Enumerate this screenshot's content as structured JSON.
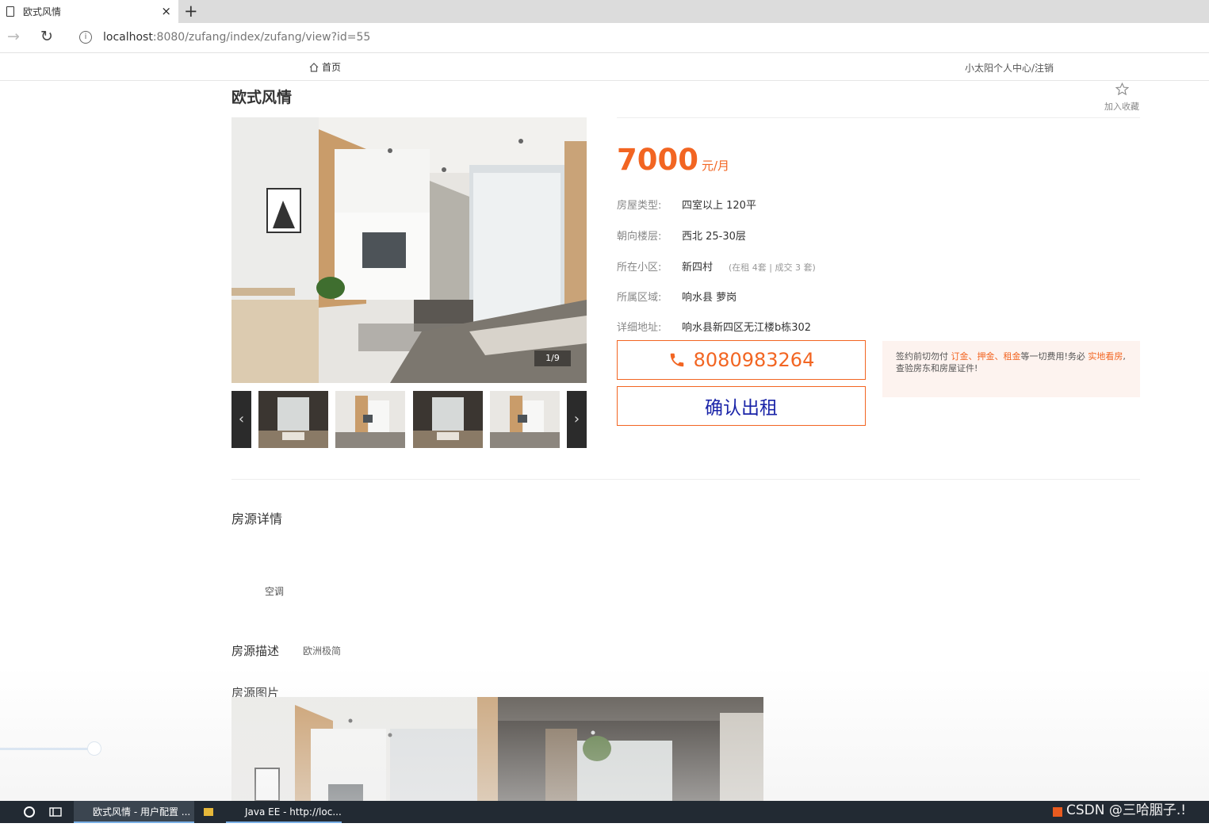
{
  "browser": {
    "tab_title": "欧式风情",
    "tab_close": "×",
    "new_tab": "+",
    "back_glyph": "→",
    "reload_glyph": "↻",
    "url_host": "localhost",
    "url_rest": ":8080/zufang/index/zufang/view?id=55"
  },
  "nav": {
    "home_label": "首页",
    "user_links": "小太阳个人中心/注销"
  },
  "house": {
    "title": "欧式风情",
    "favorite_label": "加入收藏",
    "counter": "1/9",
    "price": "7000",
    "price_unit": "元/月",
    "rows": [
      {
        "label": "房屋类型:",
        "value": "四室以上   120平"
      },
      {
        "label": "朝向楼层:",
        "value": "西北  25-30层"
      },
      {
        "label": "所在小区:",
        "value": "新四村",
        "sub": "(在租 4套 | 成交 3 套)"
      },
      {
        "label": "所属区域:",
        "value": "响水县    萝岗"
      },
      {
        "label": "详细地址:",
        "value": "响水县新四区无江楼b栋302"
      }
    ],
    "phone": "8080983264",
    "confirm_label": "确认出租",
    "notice": {
      "p1": "签约前切勿付 ",
      "h1": "订金、押金、",
      "h2": "租金",
      "p2": "等一切费用!务必 ",
      "h3": "实地看房",
      "p3": ",查验房东和房屋证件!"
    }
  },
  "detail": {
    "title": "房源详情",
    "amenity": "空调",
    "desc_title": "房源描述",
    "desc_text": "欧洲极简",
    "images_title": "房源图片"
  },
  "taskbar": {
    "edge_item": "欧式风情 - 用户配置 ...",
    "java_item": "Java EE - http://loc...",
    "watermark": "CSDN @三哈胭子.!"
  },
  "colors": {
    "accent": "#f26522",
    "confirm_text": "#1a24a8",
    "notice_bg": "#fdf3ef"
  }
}
